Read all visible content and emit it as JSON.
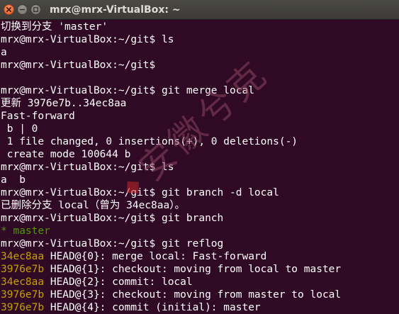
{
  "window": {
    "title": "mrx@mrx-VirtualBox: ~"
  },
  "controls": {
    "close_icon": "close-icon",
    "minimize_icon": "minimize-icon",
    "maximize_icon": "maximize-icon"
  },
  "terminal": {
    "prompt": "mrx@mrx-VirtualBox:~/git$",
    "lines": {
      "l0": "切换到分支 'master'",
      "l1": "mrx@mrx-VirtualBox:~/git$ ls",
      "l2": "a",
      "l3": "mrx@mrx-VirtualBox:~/git$",
      "l4": "",
      "l5": "mrx@mrx-VirtualBox:~/git$ git merge local",
      "l6": "更新 3976e7b..34ec8aa",
      "l7": "Fast-forward",
      "l8": " b | 0",
      "l9": " 1 file changed, 0 insertions(+), 0 deletions(-)",
      "l10": " create mode 100644 b",
      "l11": "mrx@mrx-VirtualBox:~/git$ ls",
      "l12": "a  b",
      "l13": "mrx@mrx-VirtualBox:~/git$ git branch -d local",
      "l14": "已删除分支 local（曾为 34ec8aa）。",
      "l15": "mrx@mrx-VirtualBox:~/git$ git branch",
      "l16_star": "* ",
      "l16_branch": "master",
      "l17": "mrx@mrx-VirtualBox:~/git$ git reflog"
    },
    "reflog": [
      {
        "hash": "34ec8aa",
        "text": " HEAD@{0}: merge local: Fast-forward"
      },
      {
        "hash": "3976e7b",
        "text": " HEAD@{1}: checkout: moving from local to master"
      },
      {
        "hash": "34ec8aa",
        "text": " HEAD@{2}: commit: local"
      },
      {
        "hash": "3976e7b",
        "text": " HEAD@{3}: checkout: moving from master to local"
      },
      {
        "hash": "3976e7b",
        "text": " HEAD@{4}: commit (initial): master"
      }
    ]
  },
  "watermark": {
    "logo": "◆",
    "text": "安徽兮克"
  },
  "colors": {
    "background": "#300a24",
    "text": "#ffffff",
    "branch_green": "#4e9a06",
    "hash_yellow": "#c4a000",
    "close_orange": "#e2561f"
  }
}
